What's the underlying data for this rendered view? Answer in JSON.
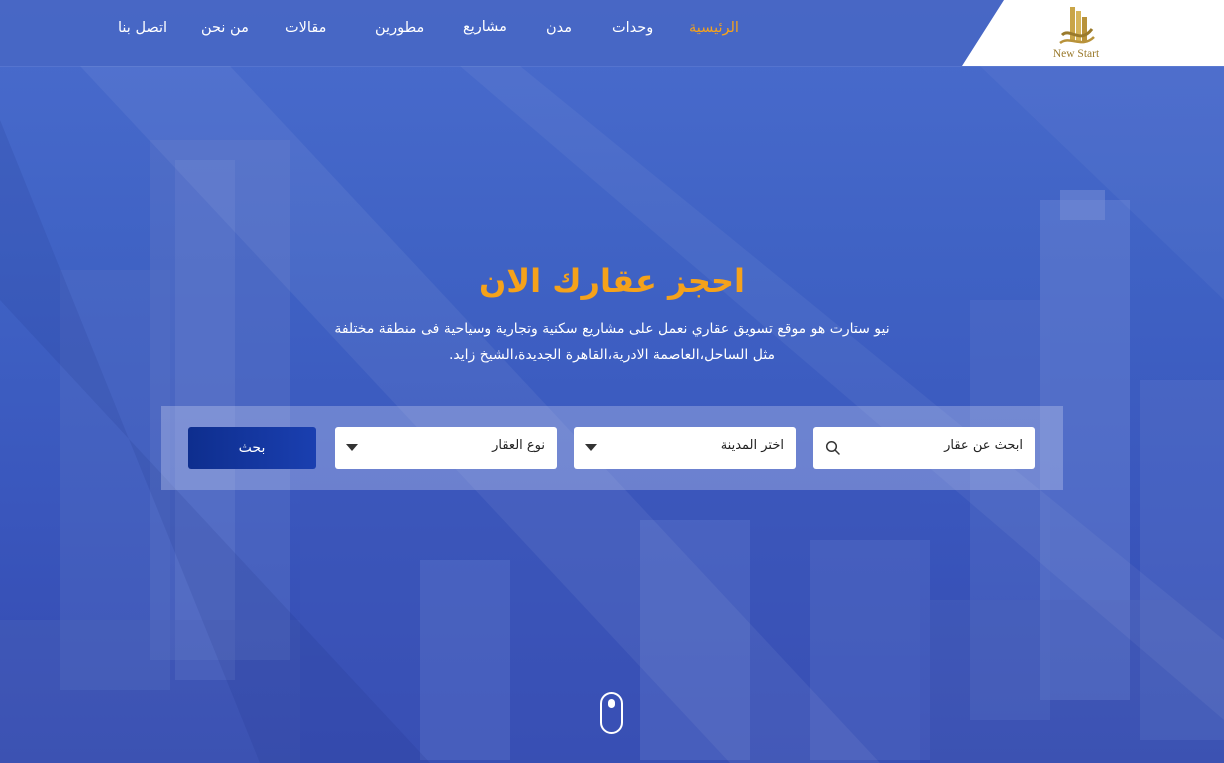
{
  "brand": {
    "name": "New Start"
  },
  "nav": {
    "items": [
      {
        "label": "الرئيسية",
        "active": true
      },
      {
        "label": "وحدات"
      },
      {
        "label": "مدن"
      },
      {
        "label": "مشاريع"
      },
      {
        "label": "مطورين"
      },
      {
        "label": "مقالات"
      },
      {
        "label": "من نحن"
      },
      {
        "label": "اتصل بنا"
      }
    ]
  },
  "hero": {
    "title": "احجز عقارك الان",
    "description": "نيو ستارت هو موقع تسويق عقاري نعمل على مشاريع سكنية وتجارية وسياحية فى منطقة مختلفة مثل الساحل،العاصمة الادرية،القاهرة الجديدة،الشيخ زايد."
  },
  "search": {
    "query_placeholder": "ابحث عن عقار",
    "city_select": "اختر المدينة",
    "type_select": "نوع العقار",
    "button_label": "بحث"
  },
  "colors": {
    "accent": "#f5a21b",
    "nav_bg": "#4867c4",
    "button": "#0e2e8e",
    "logo_gold": "#9a7a2c"
  },
  "icons": [
    "building-logo-icon",
    "search-icon",
    "chevron-down-icon",
    "scroll-mouse-icon"
  ]
}
